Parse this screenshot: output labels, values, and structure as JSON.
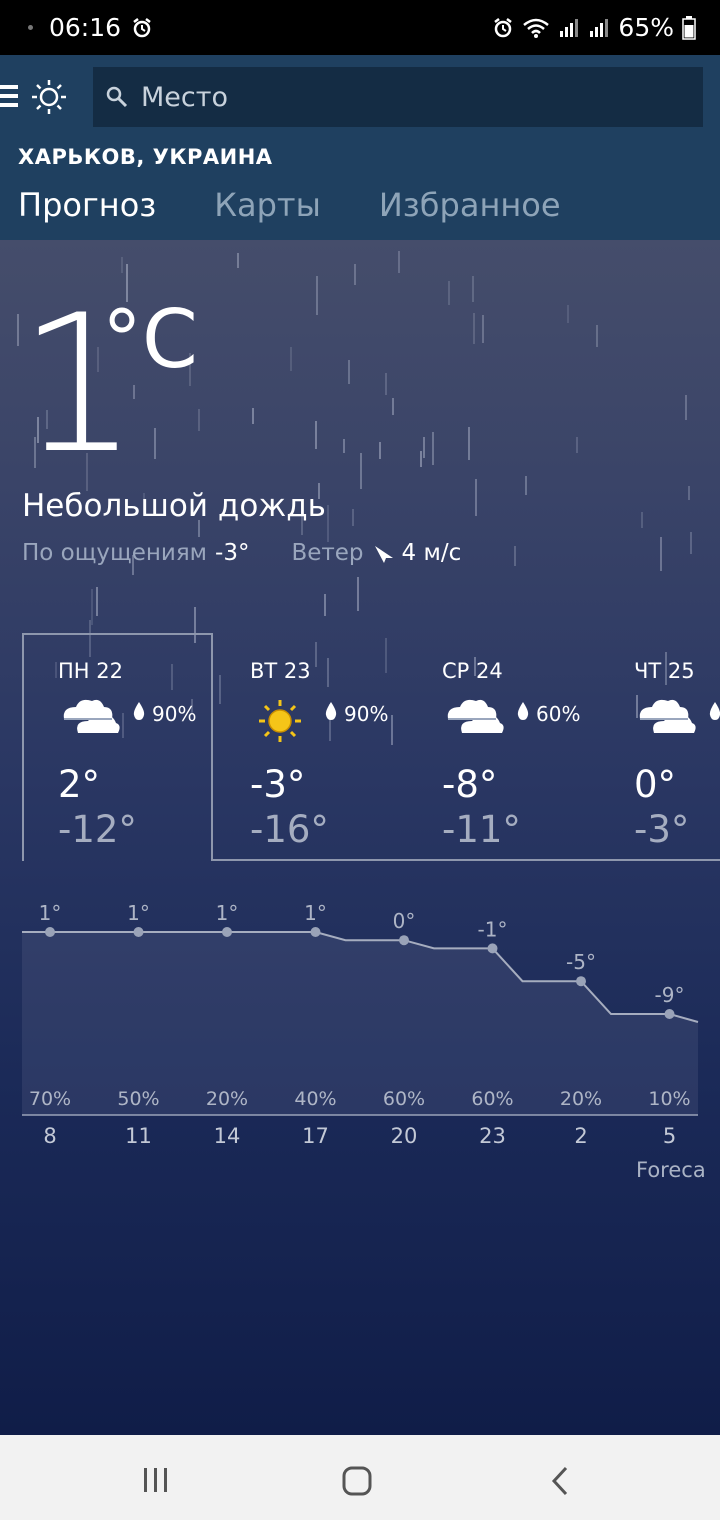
{
  "status": {
    "time": "06:16",
    "battery": "65%"
  },
  "search": {
    "placeholder": "Место"
  },
  "location": "ХАРЬКОВ, УКРАИНА",
  "tabs": [
    {
      "label": "Прогноз",
      "active": true
    },
    {
      "label": "Карты",
      "active": false
    },
    {
      "label": "Избранное",
      "active": false
    }
  ],
  "current": {
    "temp": "1",
    "unit": "°C",
    "condition": "Небольшой дождь",
    "feels_label": "По ощущениям",
    "feels_value": "-3°",
    "wind_label": "Ветер",
    "wind_value": "4 м/с"
  },
  "days": [
    {
      "name": "ПН 22",
      "icon": "cloudy-icon",
      "precip": "90%",
      "high": "2°",
      "low": "-12°"
    },
    {
      "name": "ВТ 23",
      "icon": "sun-icon",
      "precip": "90%",
      "high": "-3°",
      "low": "-16°"
    },
    {
      "name": "СР 24",
      "icon": "cloudy-icon",
      "precip": "60%",
      "high": "-8°",
      "low": "-11°"
    },
    {
      "name": "ЧТ 25",
      "icon": "cloudy-icon",
      "precip": "",
      "high": "0°",
      "low": "-3°"
    }
  ],
  "chart_data": {
    "type": "line",
    "x": [
      "8",
      "11",
      "14",
      "17",
      "20",
      "23",
      "2",
      "5"
    ],
    "temps": [
      1,
      1,
      1,
      1,
      0,
      -1,
      -5,
      -9
    ],
    "temp_labels": [
      "1°",
      "1°",
      "1°",
      "1°",
      "0°",
      "-1°",
      "-5°",
      "-9°"
    ],
    "precip": [
      "70%",
      "50%",
      "20%",
      "40%",
      "60%",
      "60%",
      "20%",
      "10%"
    ]
  },
  "credit": "Foreca",
  "colors": {
    "header": "#1f4060",
    "search": "#142c44",
    "sun": "#f5c518"
  }
}
